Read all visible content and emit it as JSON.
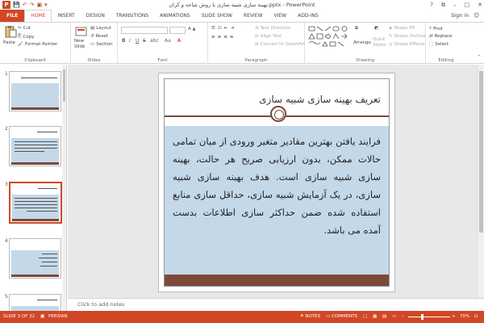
{
  "titlebar": {
    "app_letter": "P",
    "document_title": "بهینه سازی شبیه سازی با روش شاخه و کران.pptx - PowerPoint",
    "help": "?",
    "minimize": "–",
    "maximize": "□",
    "close": "✕"
  },
  "tabs": [
    "FILE",
    "HOME",
    "INSERT",
    "DESIGN",
    "TRANSITIONS",
    "ANIMATIONS",
    "SLIDE SHOW",
    "REVIEW",
    "VIEW",
    "ADD-INS"
  ],
  "account": {
    "sign_in": "Sign in"
  },
  "ribbon": {
    "clipboard": {
      "label": "Clipboard",
      "paste": "Paste",
      "cut": "Cut",
      "copy": "Copy",
      "format_painter": "Format Painter"
    },
    "slides": {
      "label": "Slides",
      "new_slide": "New",
      "new_slide2": "Slide",
      "layout": "Layout",
      "reset": "Reset",
      "section": "Section"
    },
    "font": {
      "label": "Font",
      "bold": "B",
      "italic": "I",
      "underline": "U",
      "strike": "S",
      "abc": "abc",
      "aa": "Aa"
    },
    "paragraph": {
      "label": "Paragraph",
      "text_direction": "Text Direction",
      "align_text": "Align Text",
      "smartart": "Convert to SmartArt"
    },
    "drawing": {
      "label": "Drawing",
      "arrange": "Arrange",
      "quick_styles": "Quick",
      "quick_styles2": "Styles",
      "shape_fill": "Shape Fill",
      "shape_outline": "Shape Outline",
      "shape_effects": "Shape Effects"
    },
    "editing": {
      "label": "Editing",
      "find": "Find",
      "replace": "Replace",
      "select": "Select"
    }
  },
  "thumbnails": [
    {
      "num": "1",
      "title": "بهینه سازی شبیه سازی با روش شاخه و کران"
    },
    {
      "num": "2",
      "title": "فهرست مطالب"
    },
    {
      "num": "3",
      "title": "تعریف بهینه سازی شبیه سازی"
    },
    {
      "num": "4",
      "title": ""
    },
    {
      "num": "5",
      "title": ""
    }
  ],
  "slide": {
    "title": "تعریف بهینه سازی شبیه سازی",
    "body": "فرایند یافتن بهترین مقادیر متغیر ورودی از میان تمامی حالات ممکن، بدون ارزیابی صریح هر حالت، بهینه سازی شبیه سازی است. هدف بهینه سازی شبیه سازی، در یک آزمایش شبیه سازی، حداقل سازی منابع استفاده شده ضمن حداکثر سازی اطلاعات بدست آمده می باشد."
  },
  "notes": {
    "placeholder": "Click to add notes"
  },
  "status": {
    "slide_info": "SLIDE 3 OF 32",
    "language": "PERSIAN",
    "notes": "NOTES",
    "comments": "COMMENTS",
    "zoom": "70%",
    "zoom_percent": 70
  },
  "colors": {
    "accent": "#d24726",
    "slide_band": "#7b4a3a",
    "slide_body": "#c5d8e8"
  }
}
